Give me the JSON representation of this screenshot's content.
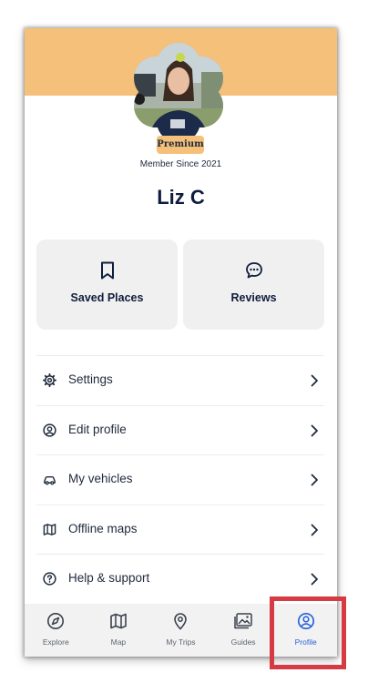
{
  "profile": {
    "badge": "Premium",
    "member_since": "Member Since 2021",
    "name": "Liz C"
  },
  "cards": {
    "saved_places": "Saved Places",
    "reviews": "Reviews"
  },
  "menu": [
    {
      "label": "Settings",
      "icon": "gear-icon"
    },
    {
      "label": "Edit profile",
      "icon": "user-circle-icon"
    },
    {
      "label": "My vehicles",
      "icon": "car-icon"
    },
    {
      "label": "Offline maps",
      "icon": "map-icon"
    },
    {
      "label": "Help & support",
      "icon": "help-circle-icon"
    }
  ],
  "tabs": [
    {
      "label": "Explore",
      "icon": "compass-icon",
      "active": false
    },
    {
      "label": "Map",
      "icon": "map-icon",
      "active": false
    },
    {
      "label": "My Trips",
      "icon": "location-pin-icon",
      "active": false
    },
    {
      "label": "Guides",
      "icon": "gallery-icon",
      "active": false
    },
    {
      "label": "Profile",
      "icon": "user-circle-icon",
      "active": true
    }
  ],
  "colors": {
    "banner": "#f4c07a",
    "active_tab": "#2a62d9",
    "highlight": "#d63a42",
    "text_dark": "#0f1d3d"
  }
}
